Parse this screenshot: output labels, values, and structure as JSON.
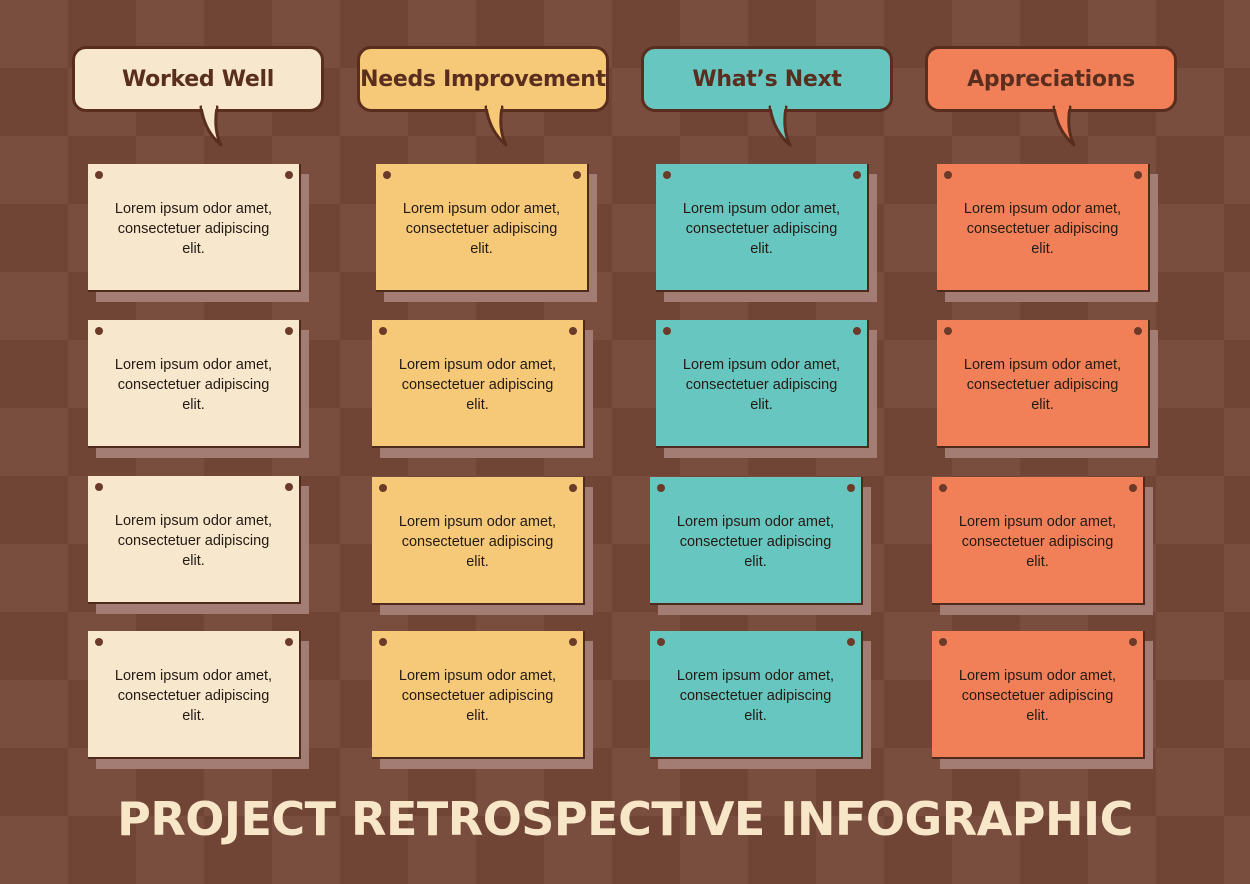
{
  "colors": {
    "background_light": "#7a4e3e",
    "background_dark": "#704535",
    "outline": "#5a2e1e",
    "cream": "#f7e7cc",
    "yellow": "#f6c978",
    "teal": "#68c6c0",
    "coral": "#f18059",
    "title_text": "#f8e6c8"
  },
  "columns": [
    {
      "header": "Worked Well",
      "color": "#f7e7cc",
      "cards": [
        "Lorem ipsum odor amet, consectetuer adipiscing elit.",
        "Lorem ipsum odor amet, consectetuer adipiscing elit.",
        "Lorem ipsum odor amet, consectetuer adipiscing elit.",
        "Lorem ipsum odor amet, consectetuer adipiscing elit."
      ]
    },
    {
      "header": "Needs Improvement",
      "color": "#f6c978",
      "cards": [
        "Lorem ipsum odor amet, consectetuer adipiscing elit.",
        "Lorem ipsum odor amet, consectetuer adipiscing elit.",
        "Lorem ipsum odor amet, consectetuer adipiscing elit.",
        "Lorem ipsum odor amet, consectetuer adipiscing elit."
      ]
    },
    {
      "header": "What’s Next",
      "color": "#68c6c0",
      "cards": [
        "Lorem ipsum odor amet, consectetuer adipiscing elit.",
        "Lorem ipsum odor amet, consectetuer adipiscing elit.",
        "Lorem ipsum odor amet, consectetuer adipiscing elit.",
        "Lorem ipsum odor amet, consectetuer adipiscing elit."
      ]
    },
    {
      "header": "Appreciations",
      "color": "#f18059",
      "cards": [
        "Lorem ipsum odor amet, consectetuer adipiscing elit.",
        "Lorem ipsum odor amet, consectetuer adipiscing elit.",
        "Lorem ipsum odor amet, consectetuer adipiscing elit.",
        "Lorem ipsum odor amet, consectetuer adipiscing elit."
      ]
    }
  ],
  "title": "PROJECT RETROSPECTIVE INFOGRAPHIC"
}
